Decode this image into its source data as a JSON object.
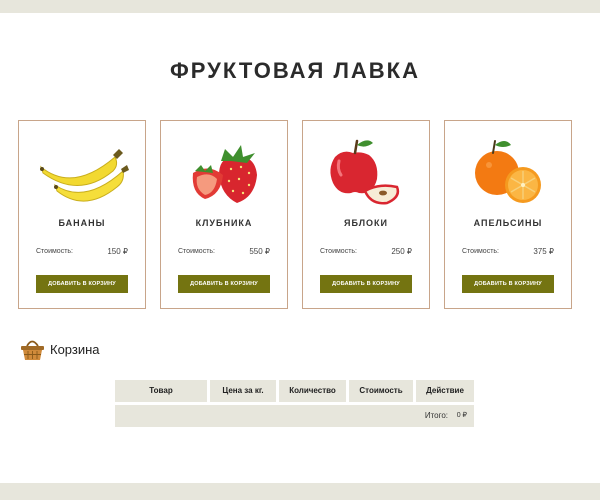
{
  "shop": {
    "title": "ФРУКТОВАЯ ЛАВКА"
  },
  "products": [
    {
      "name": "БАНАНЫ",
      "price_label": "Стоимость:",
      "price": "150 ₽",
      "button": "ДОБАВИТЬ В КОРЗИНУ",
      "icon": "banana-icon"
    },
    {
      "name": "КЛУБНИКА",
      "price_label": "Стоимость:",
      "price": "550 ₽",
      "button": "ДОБАВИТЬ В КОРЗИНУ",
      "icon": "strawberry-icon"
    },
    {
      "name": "ЯБЛОКИ",
      "price_label": "Стоимость:",
      "price": "250 ₽",
      "button": "ДОБАВИТЬ В КОРЗИНУ",
      "icon": "apple-icon"
    },
    {
      "name": "АПЕЛЬСИНЫ",
      "price_label": "Стоимость:",
      "price": "375 ₽",
      "button": "ДОБАВИТЬ В КОРЗИНУ",
      "icon": "orange-icon"
    }
  ],
  "cart": {
    "title": "Корзина",
    "icon": "basket-icon",
    "columns": [
      "Товар",
      "Цена за кг.",
      "Количество",
      "Стоимость",
      "Действие"
    ],
    "total_label": "Итого:",
    "total_value": "0 ₽"
  },
  "colors": {
    "accent_button": "#747411",
    "card_border": "#c8a58a",
    "bar_background": "#e7e6dc"
  }
}
